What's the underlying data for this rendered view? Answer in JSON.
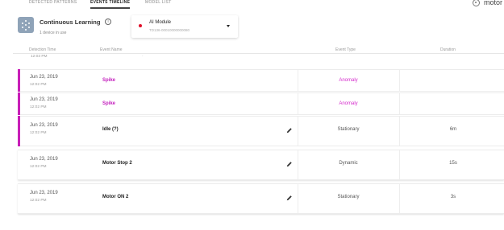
{
  "tabs": [
    "DETECTED PATTERNS",
    "EVENTS TIMELINE",
    "MODEL LIST"
  ],
  "top_right": {
    "icon": "gear-icon",
    "text": "motor"
  },
  "learning": {
    "icon": "learning-icon",
    "title": "Continuous Learning",
    "info_icon": "info-icon",
    "subtitle": "1 device in use"
  },
  "module": {
    "status_color": "#e0102a",
    "title": "AI Module",
    "id": "TD136-00010000000080",
    "caret_icon": "caret-down-icon"
  },
  "table": {
    "columns": [
      "Detection Time",
      "Event Name",
      "Event Type",
      "Duration"
    ],
    "partial_row": {
      "time": "12:03 PM",
      "name": "·"
    },
    "rows": [
      {
        "date": "Jun 23, 2019",
        "time": "12:02 PM",
        "name": "Spike",
        "type": "Anomaly",
        "duration": ""
      },
      {
        "date": "Jun 23, 2019",
        "time": "12:02 PM",
        "name": "Spike",
        "type": "Anomaly",
        "duration": ""
      },
      {
        "date": "Jun 23, 2019",
        "time": "12:02 PM",
        "name": "Idle (?)",
        "type": "Stationary",
        "duration": "6m"
      },
      {
        "date": "Jun 23, 2019",
        "time": "12:02 PM",
        "name": "Motor Stop 2",
        "type": "Dynamic",
        "duration": "15s"
      },
      {
        "date": "Jun 23, 2019",
        "time": "12:02 PM",
        "name": "Motor ON 2",
        "type": "Stationary",
        "duration": "3s"
      }
    ]
  },
  "colors": {
    "anomaly": "#d52ccc",
    "highlight_bar": "#c81fb8"
  }
}
